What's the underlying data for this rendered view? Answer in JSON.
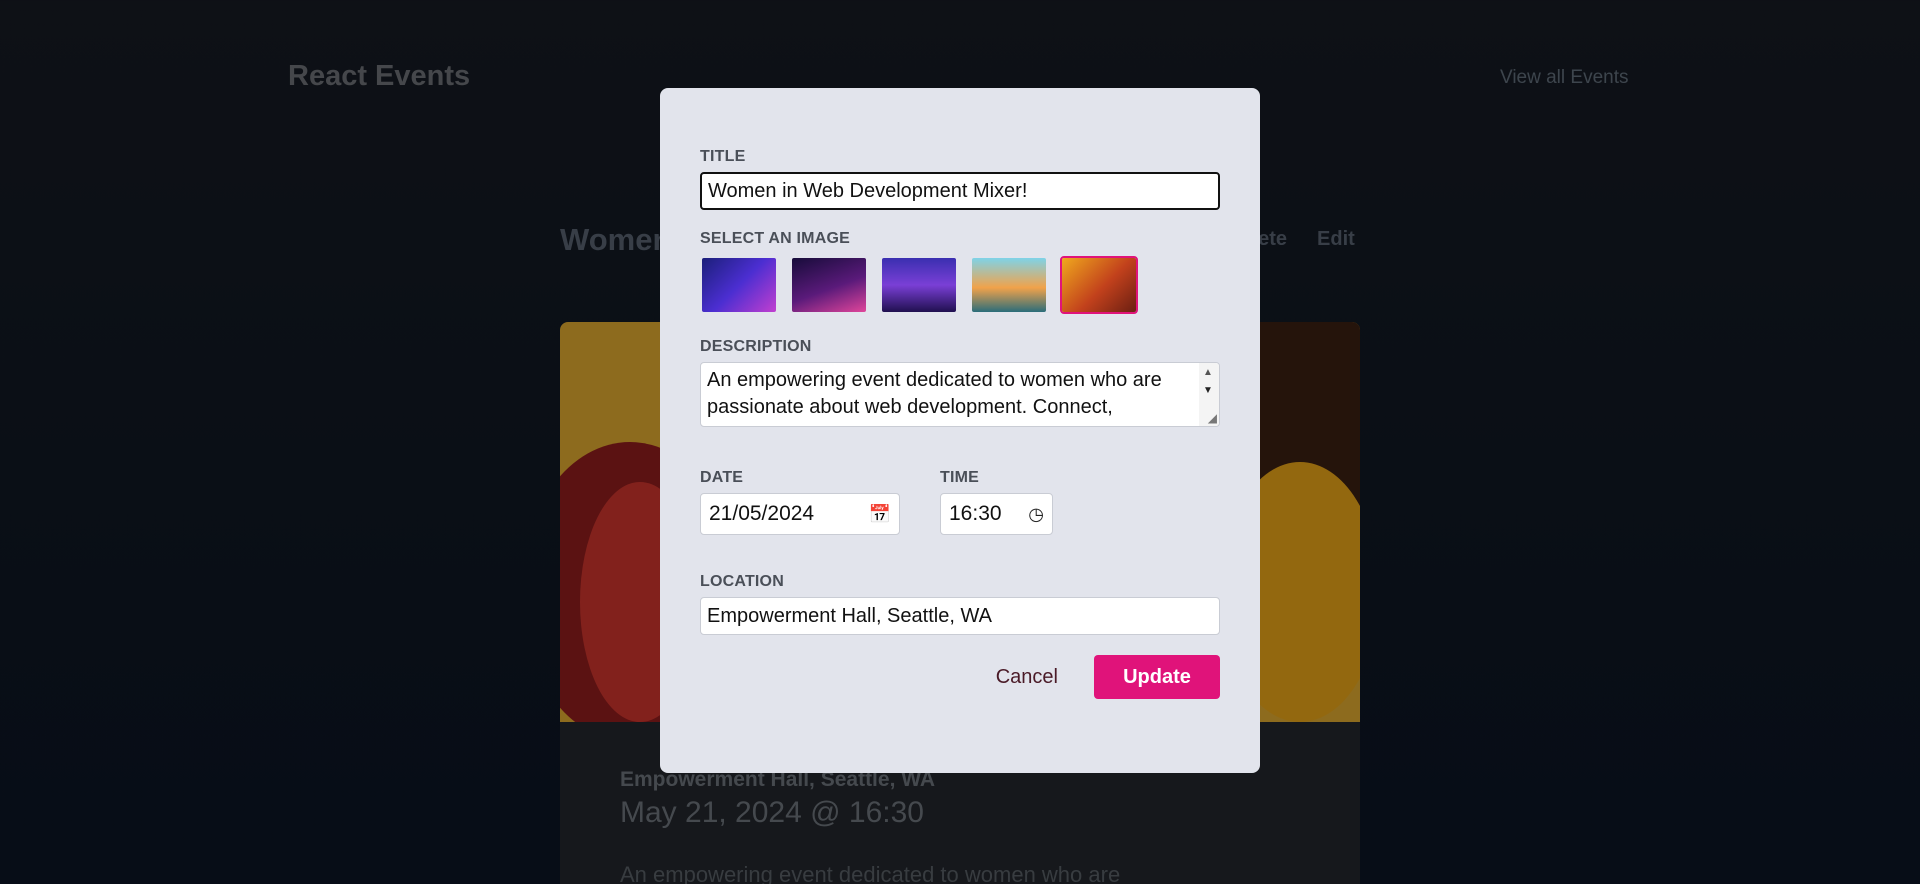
{
  "header": {
    "brand": "React Events",
    "nav_link": "View all Events"
  },
  "event": {
    "title": "Women in Web Development Mixer!",
    "actions": [
      "Delete",
      "Edit"
    ],
    "location": "Empowerment Hall, Seattle, WA",
    "datetime": "May 21, 2024 @ 16:30",
    "description": "An empowering event dedicated to women who are"
  },
  "modal": {
    "title_label": "TITLE",
    "title_value": "Women in Web Development Mixer!",
    "image_label": "SELECT AN IMAGE",
    "images": [
      "city-neon-image",
      "desk-setup-image",
      "meetup-image",
      "city-river-image",
      "women-laptop-image"
    ],
    "selected_image_index": 4,
    "description_label": "DESCRIPTION",
    "description_value": "An empowering event dedicated to women who are passionate about web development. Connect,",
    "date_label": "DATE",
    "date_value": "21/05/2024",
    "time_label": "TIME",
    "time_value": "16:30",
    "location_label": "LOCATION",
    "location_value": "Empowerment Hall, Seattle, WA",
    "cancel_label": "Cancel",
    "update_label": "Update"
  },
  "colors": {
    "accent": "#e0137a",
    "modal_bg": "#e2e4ec",
    "page_bg": "#0b1424"
  }
}
